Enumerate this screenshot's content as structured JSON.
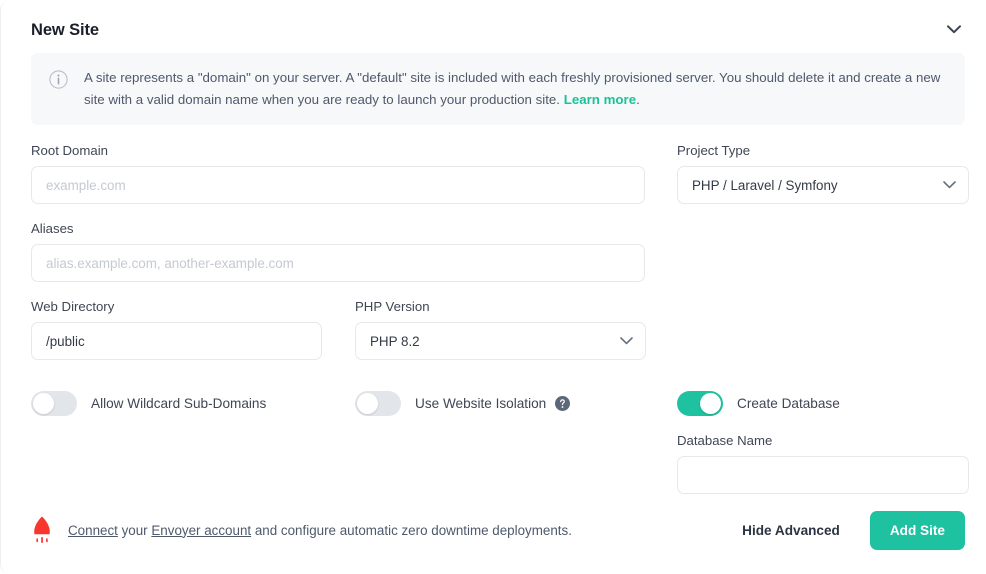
{
  "header": {
    "title": "New Site",
    "collapse_icon": "chevron-down-icon"
  },
  "banner": {
    "icon": "info-circle-icon",
    "text_before_link": "A site represents a \"domain\" on your server. A \"default\" site is included with each freshly provisioned server. You should delete it and create a new site with a valid domain name when you are ready to launch your production site. ",
    "link_label": "Learn more",
    "text_after_link": "."
  },
  "form": {
    "root_domain": {
      "label": "Root Domain",
      "value": "",
      "placeholder": "example.com"
    },
    "project_type": {
      "label": "Project Type",
      "selected": "PHP / Laravel / Symfony",
      "chevron_icon": "chevron-down-icon"
    },
    "aliases": {
      "label": "Aliases",
      "value": "",
      "placeholder": "alias.example.com, another-example.com"
    },
    "web_directory": {
      "label": "Web Directory",
      "value": "/public",
      "placeholder": ""
    },
    "php_version": {
      "label": "PHP Version",
      "selected": "PHP 8.2",
      "chevron_icon": "chevron-down-icon"
    },
    "database_name": {
      "label": "Database Name",
      "value": "",
      "placeholder": ""
    }
  },
  "toggles": {
    "wildcard": {
      "label": "Allow Wildcard Sub-Domains",
      "on": false
    },
    "isolation": {
      "label": "Use Website Isolation",
      "on": false,
      "help_icon": "question-circle-icon"
    },
    "database": {
      "label": "Create Database",
      "on": true
    }
  },
  "footer": {
    "icon": "rocket-icon",
    "link_connect": "Connect",
    "text_mid": " your ",
    "link_envoyer": "Envoyer account",
    "text_end": " and configure automatic zero downtime deployments.",
    "hide_advanced_label": "Hide Advanced",
    "add_site_label": "Add Site"
  },
  "colors": {
    "accent": "#1ec2a0",
    "link": "#19c29a",
    "rocket": "#f7372e",
    "banner_bg": "#f7f8fa",
    "border": "#e6e8ec",
    "text": "#3f4654"
  }
}
